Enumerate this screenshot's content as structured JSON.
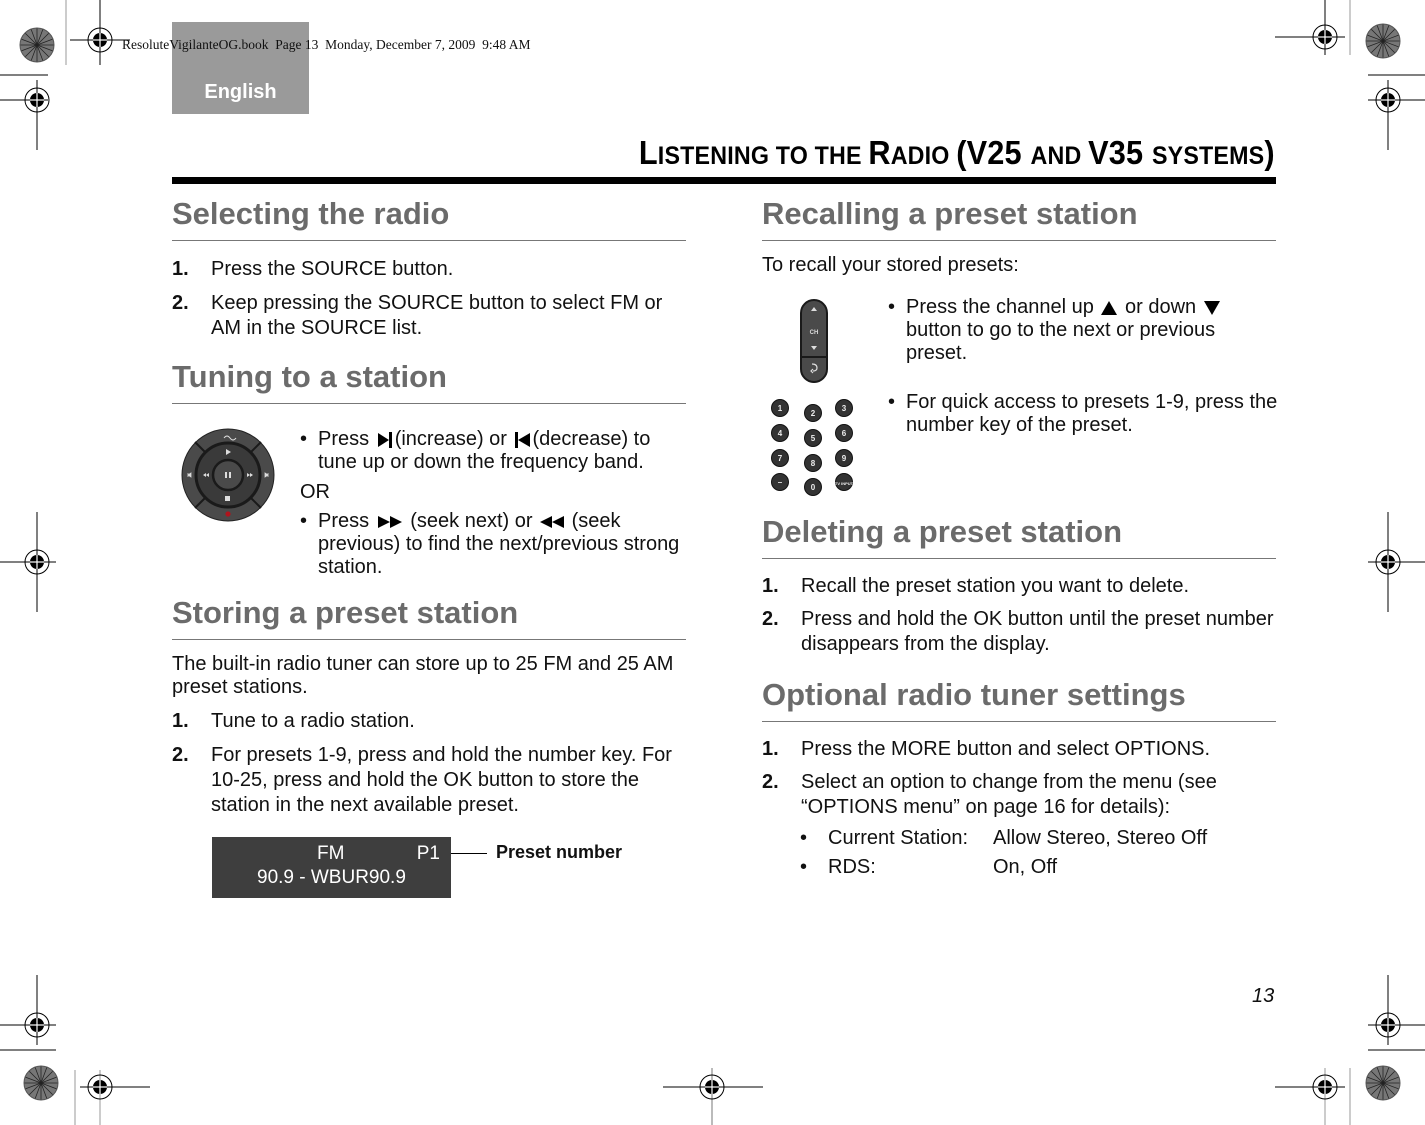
{
  "print_header": "ResoluteVigilanteOG.book  Page 13  Monday, December 7, 2009  9:48 AM",
  "language_tab": "English",
  "page_title": {
    "parts": [
      {
        "text": "L",
        "big": true
      },
      {
        "text": "ISTENING TO THE ",
        "big": false
      },
      {
        "text": "R",
        "big": true
      },
      {
        "text": "ADIO ",
        "big": false
      },
      {
        "text": "(V25 ",
        "big": true
      },
      {
        "text": "AND ",
        "big": false
      },
      {
        "text": "V35 ",
        "big": true
      },
      {
        "text": "SYSTEMS",
        "big": false
      },
      {
        "text": ")",
        "big": true
      }
    ],
    "full": "LISTENING TO THE RADIO (V25 AND V35 SYSTEMS)"
  },
  "left": {
    "selecting": {
      "heading": "Selecting the radio",
      "steps": [
        {
          "n": "1.",
          "text": "Press the SOURCE button."
        },
        {
          "n": "2.",
          "text": "Keep pressing the SOURCE button to select FM or AM in the SOURCE list."
        }
      ]
    },
    "tuning": {
      "heading": "Tuning to a station",
      "bullet1": {
        "a": "Press",
        "b": "(increase) or",
        "c": "(decrease) to tune up or down the frequency band."
      },
      "or": "OR",
      "bullet2": {
        "a": "Press",
        "b": "(seek next) or",
        "c": "(seek previous) to find the next/previous strong station."
      },
      "icons": [
        "skip-next-icon",
        "skip-previous-icon",
        "fast-forward-icon",
        "rewind-icon"
      ]
    },
    "storing": {
      "heading": "Storing a preset station",
      "intro": "The built-in radio tuner can store up to 25 FM and 25 AM preset stations.",
      "steps": [
        {
          "n": "1.",
          "text": "Tune to a radio station."
        },
        {
          "n": "2.",
          "text": "For presets 1-9, press and hold the number key. For 10-25, press and hold the OK button to store the station in the next available preset."
        }
      ],
      "display": {
        "band": "FM",
        "preset": "P1",
        "station": "90.9 - WBUR90.9"
      },
      "callout": "Preset number"
    }
  },
  "right": {
    "recalling": {
      "heading": "Recalling a preset station",
      "intro": "To recall your stored presets:",
      "bullet1": {
        "a": "Press the channel up",
        "b": "or down",
        "c": "button to go to the next or previous preset."
      },
      "bullet2": "For quick access to presets 1-9, press the number key of the preset.",
      "ch_label": "CH",
      "keypad": [
        "1",
        "2",
        "3",
        "4",
        "5",
        "6",
        "7",
        "8",
        "9",
        "–",
        "0",
        "TV INPUT"
      ]
    },
    "deleting": {
      "heading": "Deleting a preset station",
      "steps": [
        {
          "n": "1.",
          "text": "Recall the preset station you want to delete."
        },
        {
          "n": "2.",
          "text": "Press and hold the OK button until the preset number disappears from the display."
        }
      ]
    },
    "optional": {
      "heading": "Optional radio tuner settings",
      "steps": [
        {
          "n": "1.",
          "text": "Press the MORE button and select OPTIONS."
        },
        {
          "n": "2.",
          "text": "Select an option to change from the menu (see “OPTIONS menu” on page 16 for details):"
        }
      ],
      "options": [
        {
          "key": "Current Station:",
          "value": "Allow Stereo, Stereo Off"
        },
        {
          "key": "RDS:",
          "value": "On, Off"
        }
      ]
    }
  },
  "page_number": "13",
  "colors": {
    "heading_gray": "#6b6b6b",
    "tab_gray": "#9a9a9a",
    "lcd_bg": "#3e3e3e",
    "record_red": "#b0141c"
  }
}
